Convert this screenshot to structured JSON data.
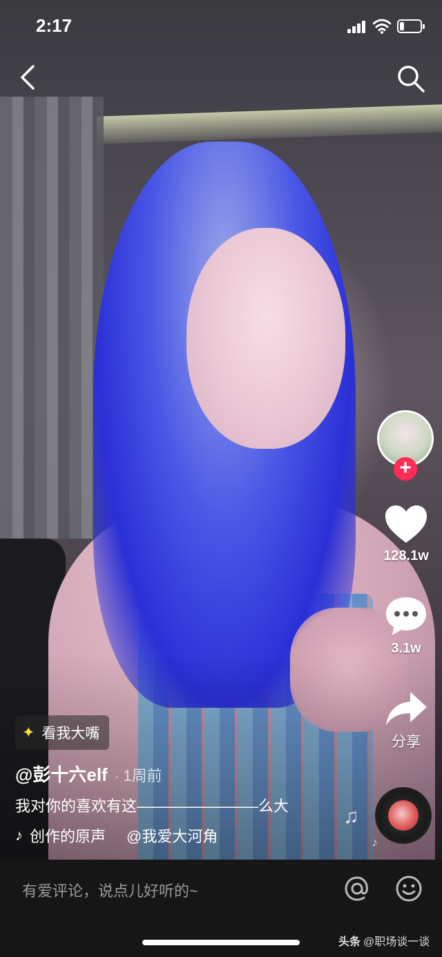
{
  "status_bar": {
    "time": "2:17",
    "battery_level": 0.2
  },
  "nav": {
    "back_icon": "chevron-left-icon",
    "search_icon": "search-icon"
  },
  "right_rail": {
    "likes": "128.1w",
    "comments": "3.1w",
    "share_label": "分享",
    "follow_symbol": "+"
  },
  "video_info": {
    "tag_label": "看我大嘴",
    "author": "@彭十六elf",
    "time_ago": "1周前",
    "caption": "我对你的喜欢有这————————么大",
    "sound": "创作的原声",
    "sound_author": "@我爱大河角"
  },
  "comment_bar": {
    "placeholder": "有爱评论，说点儿好听的~"
  },
  "watermark": {
    "brand": "头条",
    "account": "@职场谈一谈"
  },
  "colors": {
    "follow": "#ff2c55",
    "bar_bg": "#161616"
  }
}
